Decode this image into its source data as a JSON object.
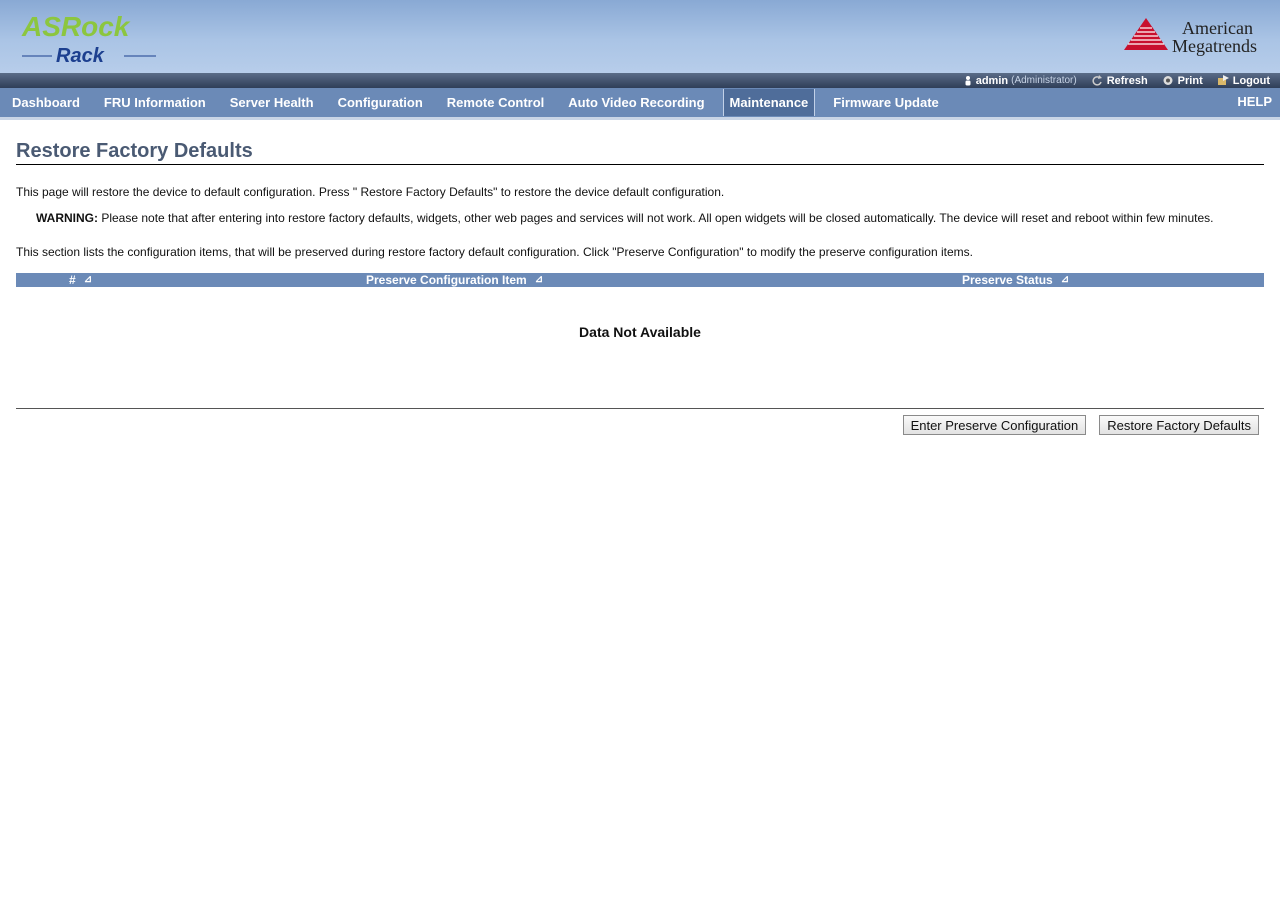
{
  "brand": {
    "left_logo_top": "ASRock",
    "left_logo_bottom": "Rack",
    "right_logo_line1": "American",
    "right_logo_line2": "Megatrends"
  },
  "topbar": {
    "user": "admin",
    "role": "(Administrator)",
    "refresh": "Refresh",
    "print": "Print",
    "logout": "Logout"
  },
  "nav": {
    "items": [
      {
        "label": "Dashboard"
      },
      {
        "label": "FRU Information"
      },
      {
        "label": "Server Health"
      },
      {
        "label": "Configuration"
      },
      {
        "label": "Remote Control"
      },
      {
        "label": "Auto Video Recording"
      },
      {
        "label": "Maintenance"
      },
      {
        "label": "Firmware Update"
      }
    ],
    "active": "Maintenance",
    "help": "HELP"
  },
  "page": {
    "title": "Restore Factory Defaults",
    "intro": "This page will restore the device to default configuration. Press \" Restore Factory Defaults\" to restore the device default configuration.",
    "warning_label": "WARNING:",
    "warning_text": " Please note that after entering into restore factory defaults, widgets, other web pages and services will not work. All open widgets will be closed automatically. The device will reset and reboot within few minutes.",
    "section_text": "This section lists the configuration items, that will be preserved during restore factory default configuration. Click \"Preserve Configuration\" to modify the preserve configuration items."
  },
  "table": {
    "columns": [
      "#",
      "Preserve Configuration Item",
      "Preserve Status"
    ],
    "sort_glyph": "⊿",
    "empty_text": "Data Not Available"
  },
  "buttons": {
    "enter_preserve": "Enter Preserve Configuration",
    "restore": "Restore Factory Defaults"
  },
  "colors": {
    "nav": "#6b8ab7",
    "title": "#4a5a73",
    "asrock_green": "#8cc63f",
    "asrock_blue": "#1c3f8f",
    "ami_red": "#c8102e"
  }
}
